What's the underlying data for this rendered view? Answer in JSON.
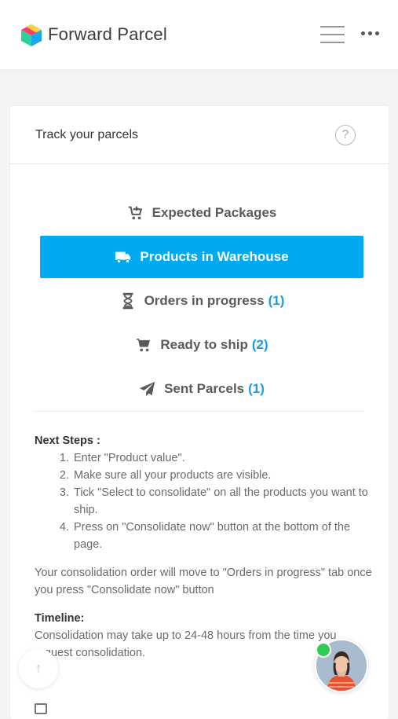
{
  "header": {
    "brand": "Forward Parcel",
    "logo_icon": "cube-logo",
    "menu_icon": "hamburger-icon",
    "more_icon": "more-dots-icon"
  },
  "card": {
    "title": "Track your parcels",
    "help_icon": "question-circle-icon",
    "help_symbol": "?"
  },
  "tabs": [
    {
      "label": "Expected Packages",
      "count": "",
      "icon": "cart-plus-icon",
      "active": false
    },
    {
      "label": "Products in Warehouse",
      "count": "",
      "icon": "truck-icon",
      "active": true
    },
    {
      "label": "Orders in progress",
      "count": "(1)",
      "icon": "hourglass-icon",
      "active": false
    },
    {
      "label": "Ready to ship",
      "count": "(2)",
      "icon": "cart-icon",
      "active": false
    },
    {
      "label": "Sent Parcels",
      "count": "(1)",
      "icon": "paper-plane-icon",
      "active": false
    }
  ],
  "next_steps": {
    "heading": "Next Steps :",
    "items": [
      "Enter \"Product value\".",
      "Make sure all your products are visible.",
      "Tick \"Select to consolidate\" on all the products you want to ship.",
      "Press on \"Consolidate now\" button at the bottom of the page."
    ]
  },
  "note": "Your consolidation order will move to \"Orders in progress\" tab once you press \"Consolidate now\" button",
  "timeline": {
    "heading": "Timeline:",
    "text": "Consolidation may take up to 24-48 hours from the time you request consolidation."
  },
  "floating": {
    "scroll_top_icon": "arrow-up-icon",
    "scroll_top_symbol": "↑",
    "chat_avatar": "support-agent-avatar",
    "online_color": "#2ecc55"
  },
  "colors": {
    "accent": "#00aaf0",
    "count": "#1d9be6"
  }
}
